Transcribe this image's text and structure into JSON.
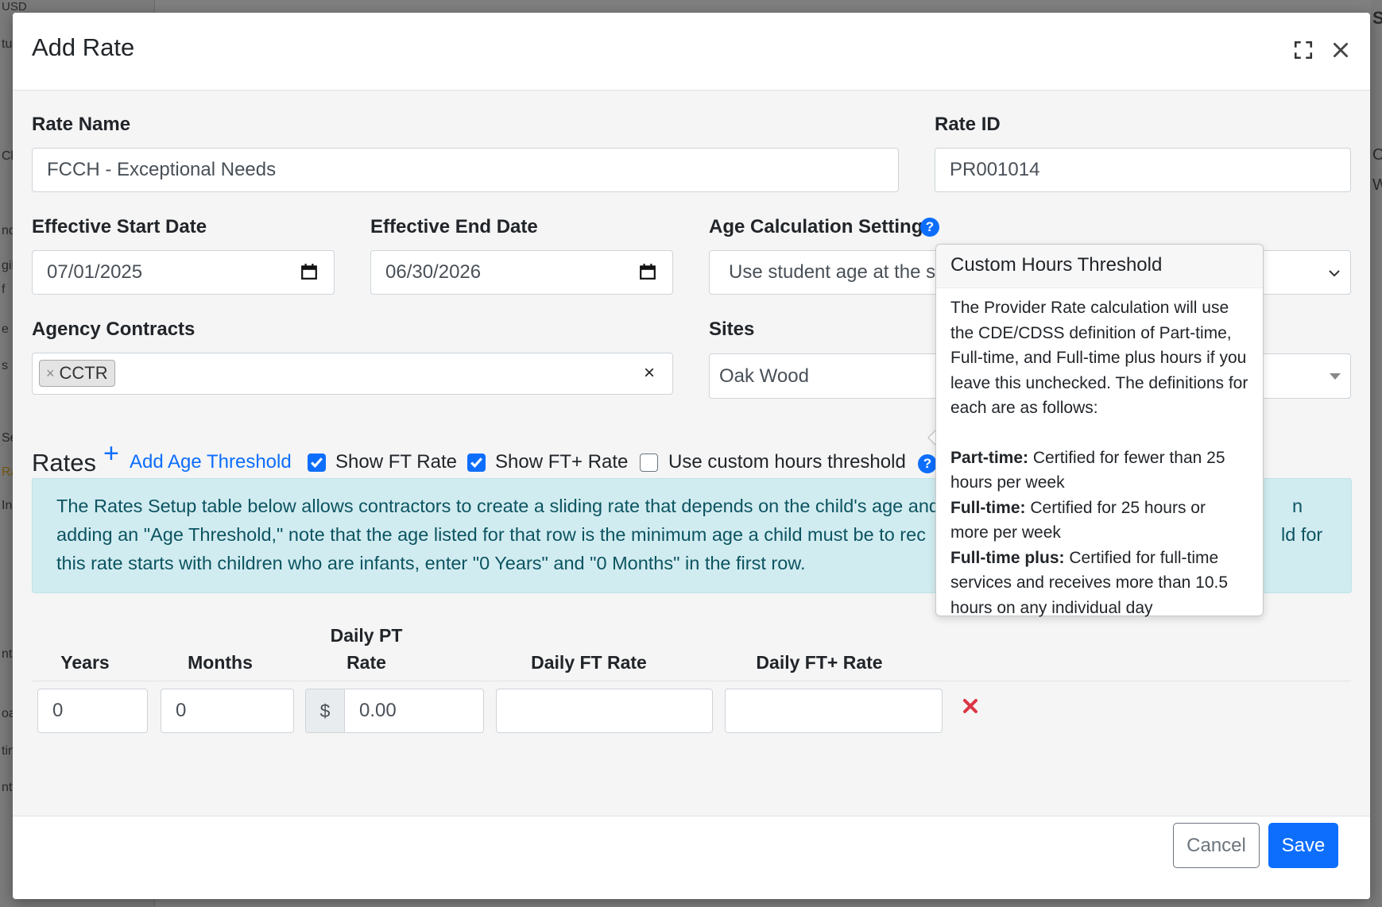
{
  "background": {
    "fragments": [
      "USD",
      "tu",
      "Cla",
      "nd",
      "gib",
      "f",
      "e",
      "s",
      "Se",
      "Ra",
      "In",
      "nts",
      "oa",
      "tin",
      "nty",
      "S",
      "O",
      "W"
    ]
  },
  "modal": {
    "title": "Add Rate",
    "icons": {
      "maximize": "maximize-icon",
      "close": "close-icon"
    }
  },
  "form": {
    "rate_name": {
      "label": "Rate Name",
      "value": "FCCH - Exceptional Needs"
    },
    "rate_id": {
      "label": "Rate ID",
      "value": "PR001014"
    },
    "start_date": {
      "label": "Effective Start Date",
      "value": "07/01/2025"
    },
    "end_date": {
      "label": "Effective End Date",
      "value": "06/30/2026"
    },
    "age_setting": {
      "label": "Age Calculation Setting",
      "value": "Use student age at the sta"
    },
    "agency_contracts": {
      "label": "Agency Contracts",
      "chips": [
        "CCTR"
      ],
      "clear": "×"
    },
    "sites": {
      "label": "Sites",
      "value": "Oak Wood"
    }
  },
  "rates": {
    "title": "Rates",
    "add_threshold": "Add Age Threshold",
    "show_ft": {
      "label": "Show FT Rate",
      "checked": true
    },
    "show_ftplus": {
      "label": "Show FT+ Rate",
      "checked": true
    },
    "custom_hours": {
      "label": "Use custom hours threshold",
      "checked": false
    },
    "info_lines": [
      "The Rates Setup table below allows contractors to create a sliding rate that depends on the child's age and",
      "adding an \"Age Threshold,\" note that the age listed for that row is the minimum age a child must be to rec",
      "this rate starts with children who are infants, enter \"0 Years\" and \"0 Months\" in the first row."
    ],
    "info_overflow": {
      "line1_end": "n",
      "line2_end": "ld for"
    },
    "columns": [
      "Years",
      "Months",
      "Daily PT",
      "Rate",
      "Daily FT Rate",
      "Daily FT+ Rate"
    ],
    "rows": [
      {
        "years": "0",
        "months": "0",
        "currency": "$",
        "pt_rate": "0.00",
        "ft_rate": "",
        "ftplus_rate": ""
      }
    ]
  },
  "popover": {
    "title": "Custom Hours Threshold",
    "intro_lines": [
      "The Provider Rate calculation will use",
      "the CDE/CDSS definition of Part-time,",
      "Full-time, and Full-time plus hours if you",
      "leave this unchecked. The definitions for",
      "each are as follows:"
    ],
    "defs": [
      {
        "term": "Part-time:",
        "line1": "Certified for fewer than 25",
        "line2": "hours per week",
        "line3": ""
      },
      {
        "term": "Full-time:",
        "line1": "Certified for 25 hours or",
        "line2": "more per week",
        "line3": ""
      },
      {
        "term": "Full-time plus:",
        "line1": "Certified for full-time",
        "line2": "services and receives more than 10.5",
        "line3": "hours on any individual day"
      }
    ]
  },
  "footer": {
    "cancel": "Cancel",
    "save": "Save"
  },
  "colors": {
    "primary": "#0d6efd",
    "danger": "#dc3545",
    "info_bg": "#d1ecf1",
    "info_text": "#0c5460"
  }
}
